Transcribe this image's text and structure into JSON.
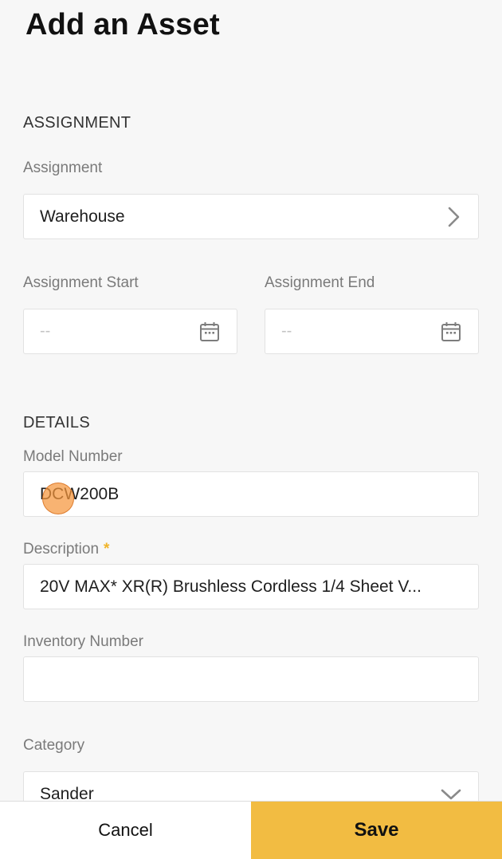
{
  "page": {
    "title": "Add an Asset"
  },
  "assignment_section": {
    "heading": "ASSIGNMENT",
    "assignment": {
      "label": "Assignment",
      "value": "Warehouse",
      "icon": "chevron-right-icon"
    },
    "start": {
      "label": "Assignment Start",
      "placeholder": "--",
      "icon": "calendar-icon"
    },
    "end": {
      "label": "Assignment End",
      "placeholder": "--",
      "icon": "calendar-icon"
    }
  },
  "details_section": {
    "heading": "DETAILS",
    "model_number": {
      "label": "Model Number",
      "value": "DCW200B"
    },
    "description": {
      "label": "Description",
      "required_mark": "*",
      "value": "20V MAX* XR(R) Brushless Cordless 1/4 Sheet V..."
    },
    "inventory_number": {
      "label": "Inventory Number",
      "value": ""
    },
    "category": {
      "label": "Category",
      "value": "Sander",
      "icon": "chevron-down-icon"
    }
  },
  "actions": {
    "cancel_label": "Cancel",
    "save_label": "Save"
  },
  "colors": {
    "accent": "#f2bc42",
    "required": "#f0b429",
    "label": "#7a7a7a",
    "border": "#e2e2e2",
    "background": "#f7f7f7"
  }
}
